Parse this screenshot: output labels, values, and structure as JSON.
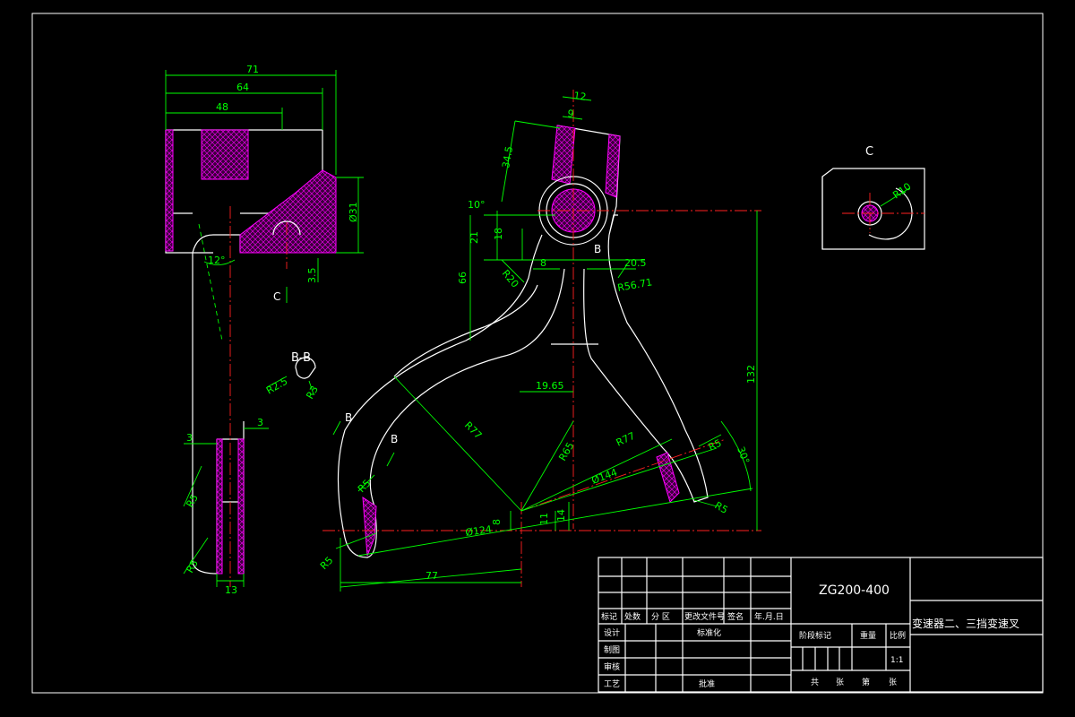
{
  "title_block": {
    "drawing_number": "ZG200-400",
    "part_name": "变速器二、三挡变速叉",
    "header_cells": [
      "标记",
      "处数",
      "分 区",
      "更改文件号",
      "签名",
      "年.月.日"
    ],
    "left_labels": [
      "设计",
      "制图",
      "审核",
      "工艺"
    ],
    "standardize": "标准化",
    "approve": "批准",
    "stage_mark": "阶段标记",
    "weight": "重量",
    "scale_label": "比例",
    "scale_value": "1:1",
    "sheets": [
      "共",
      "张",
      "第",
      "张"
    ]
  },
  "view_labels": {
    "section_bb": "B-B",
    "view_c": "C",
    "arrow_c": "C",
    "arrow_b_1": "B",
    "arrow_b_2": "B",
    "arrow_b_3": "B"
  },
  "dimensions": {
    "side_view": [
      "71",
      "64",
      "48",
      "Ø31",
      "3.5",
      "12°",
      "3",
      "3",
      "R5",
      "R5",
      "13",
      "R2.5",
      "R3"
    ],
    "front_view": [
      "12",
      "9",
      "34.5",
      "10°",
      "21",
      "18",
      "8",
      "20.5",
      "R20",
      "66",
      "R56.71",
      "132",
      "19.65",
      "R77",
      "R65",
      "R77",
      "R5",
      "30°",
      "Ø144",
      "R5",
      "8",
      "11",
      "14",
      "Ø124",
      "R5",
      "R5",
      "77"
    ],
    "detail_c": [
      "R10"
    ]
  },
  "colors": {
    "background": "#000000",
    "outline": "#ffffff",
    "dimension": "#00ff00",
    "centerline": "#ff2020",
    "hatch": "#ff00ff"
  }
}
